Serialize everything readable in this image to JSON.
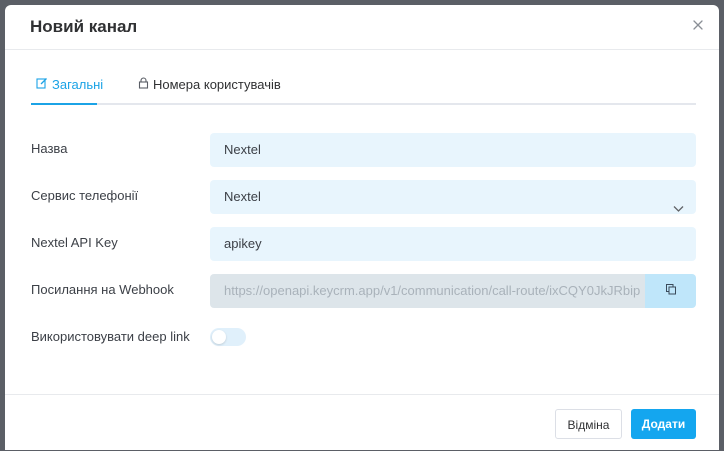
{
  "dialog": {
    "title": "Новий канал"
  },
  "tabs": [
    {
      "label": "Загальні",
      "icon": "edit-icon",
      "active": true
    },
    {
      "label": "Номера користувачів",
      "icon": "lock-icon",
      "active": false
    }
  ],
  "form": {
    "name": {
      "label": "Назва",
      "value": "Nextel"
    },
    "telephony_service": {
      "label": "Сервис телефонії",
      "value": "Nextel"
    },
    "api_key": {
      "label": "Nextel API Key",
      "value": "apikey"
    },
    "webhook": {
      "label": "Посилання на Webhook",
      "value": "https://openapi.keycrm.app/v1/communication/call-route/ixCQY0JkJRbip"
    },
    "deep_link": {
      "label": "Використовувати deep link",
      "enabled": false
    }
  },
  "footer": {
    "cancel_label": "Відміна",
    "add_label": "Додати"
  },
  "colors": {
    "accent": "#1ba3e6",
    "field_bg": "#e8f5fd",
    "primary_button": "#14a6ef"
  }
}
